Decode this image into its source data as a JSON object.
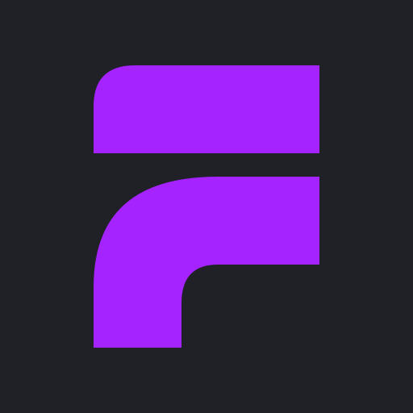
{
  "app_icon": {
    "name": "F",
    "background_color": "#1F2126",
    "accent_color": "#A423FF",
    "icon": "letter-f-logo-icon"
  }
}
